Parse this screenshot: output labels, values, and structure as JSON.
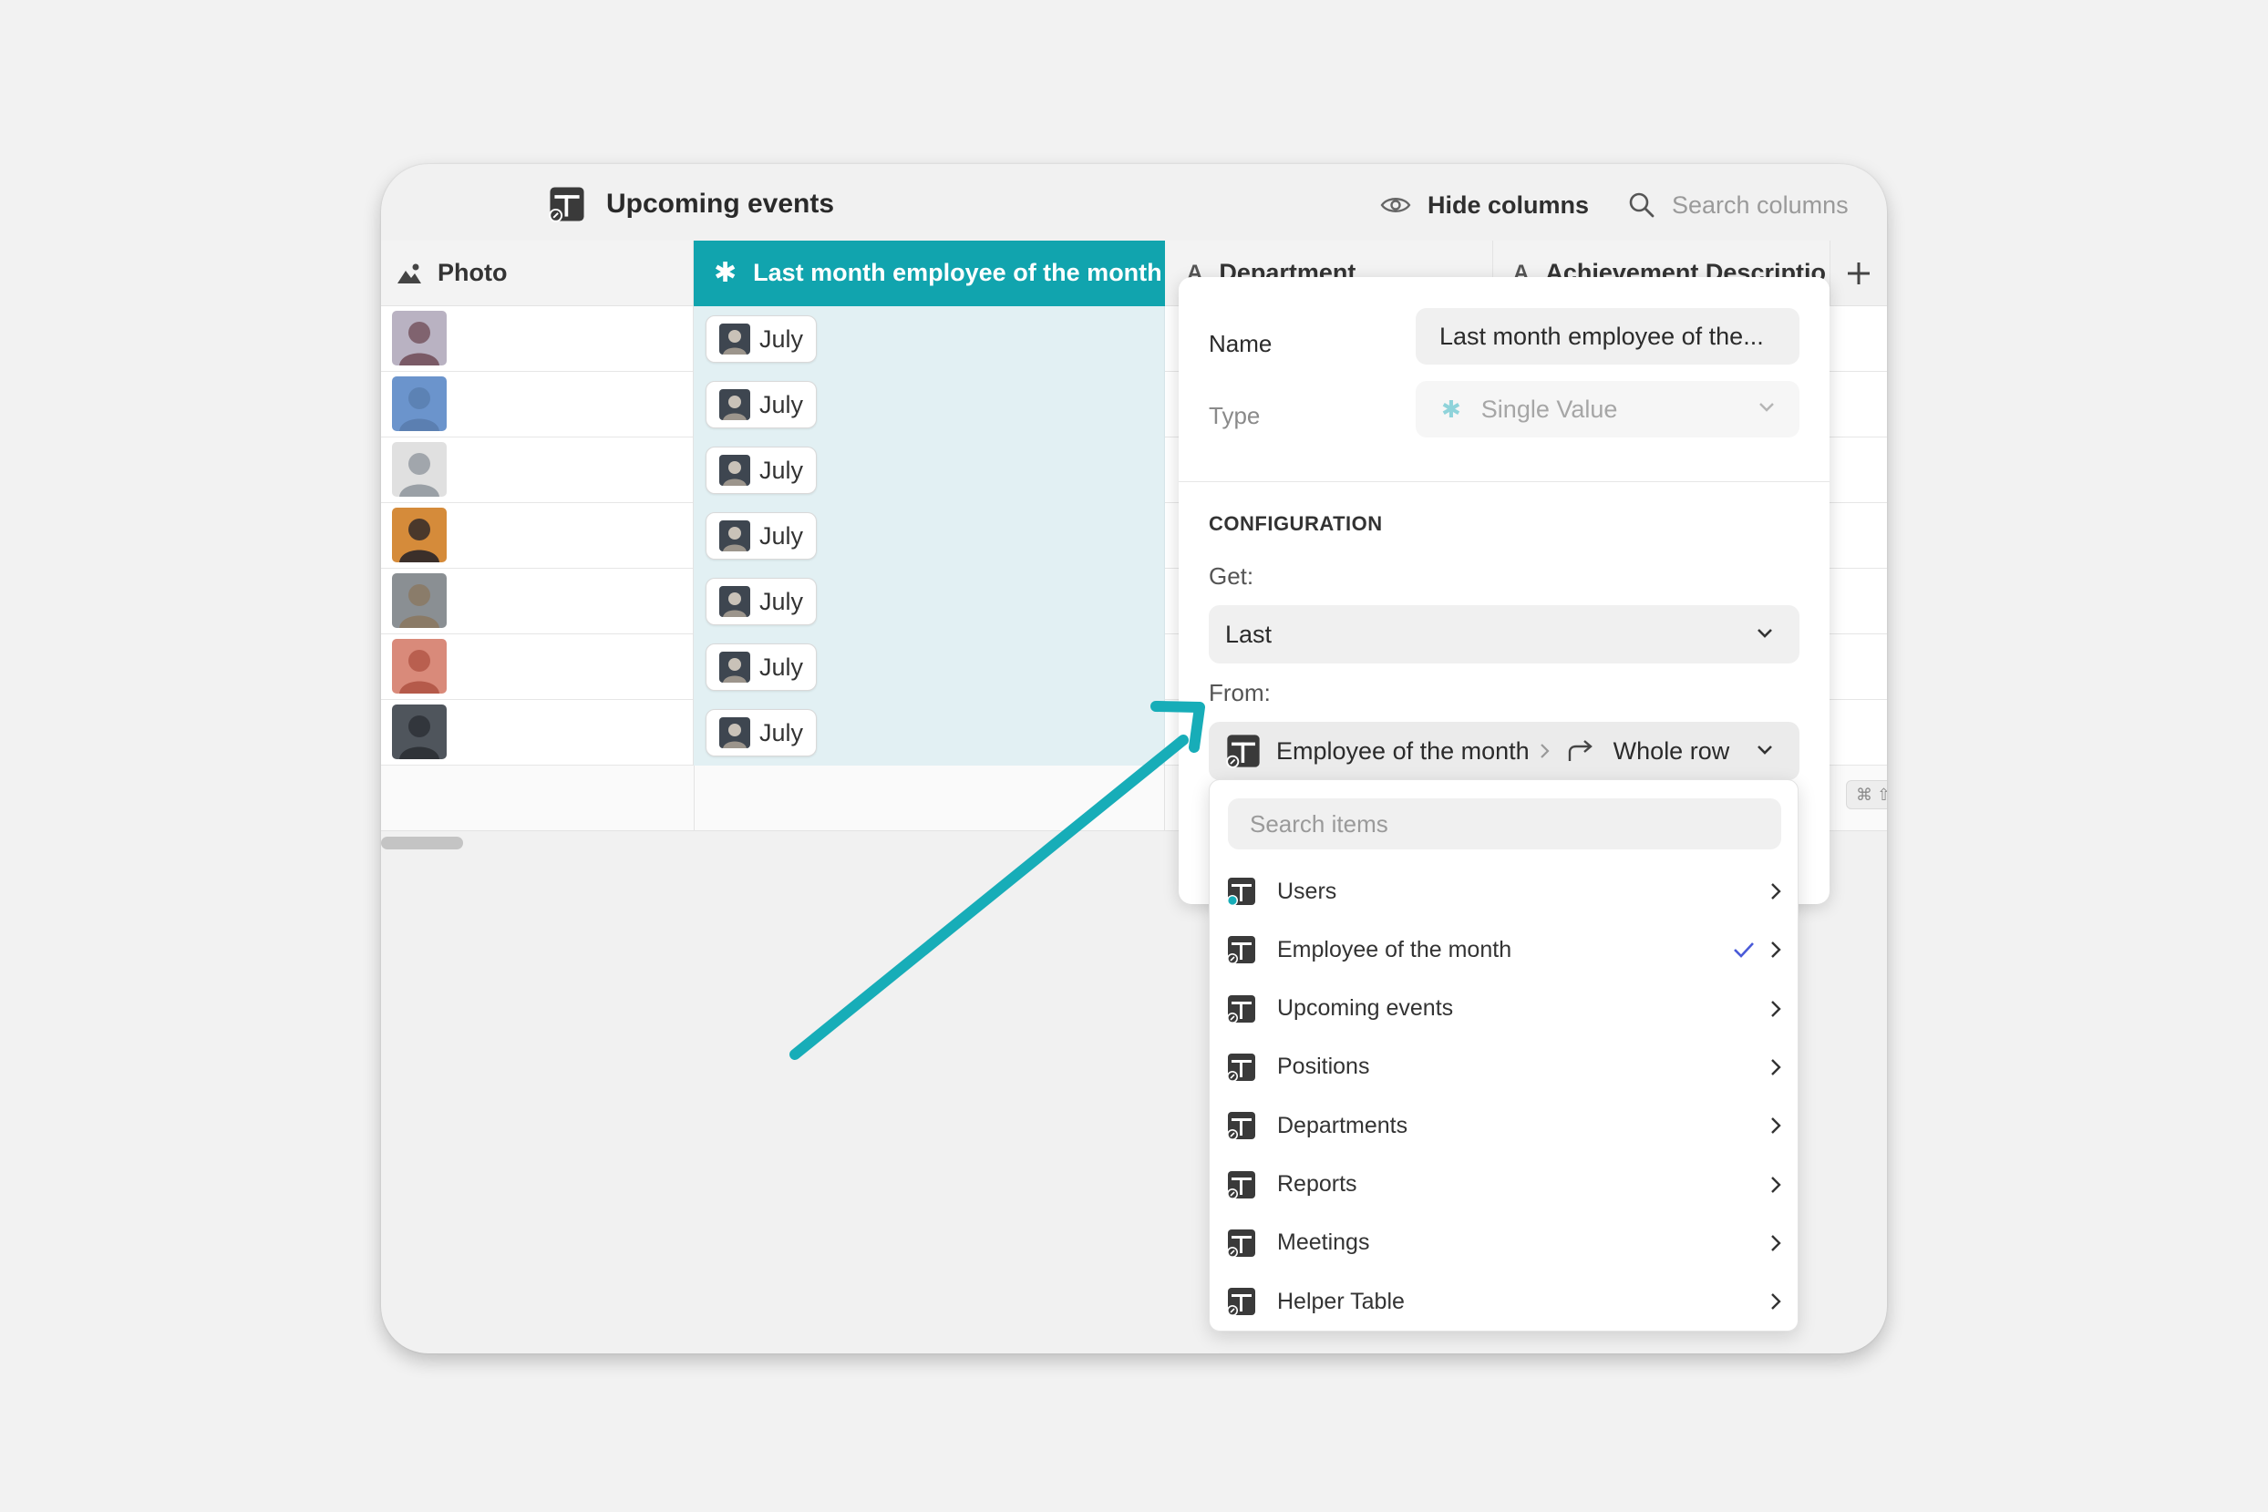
{
  "header": {
    "table_name": "Upcoming events",
    "hide_columns_label": "Hide columns",
    "search_placeholder": "Search columns"
  },
  "columns": [
    {
      "label": "Photo",
      "icon": "image-icon"
    },
    {
      "label": "Last month employee of the month",
      "icon": "asterisk-icon"
    },
    {
      "label": "Department",
      "icon": "text-icon"
    },
    {
      "label": "Achievement Descriptio",
      "icon": "text-icon"
    }
  ],
  "rows": [
    {
      "value": "July"
    },
    {
      "value": "July"
    },
    {
      "value": "July"
    },
    {
      "value": "July"
    },
    {
      "value": "July"
    },
    {
      "value": "July"
    },
    {
      "value": "July"
    }
  ],
  "panel": {
    "name_label": "Name",
    "name_value": "Last month employee of the...",
    "type_label": "Type",
    "type_value": "Single Value",
    "section_title": "CONFIGURATION",
    "get_label": "Get:",
    "get_value": "Last",
    "from_label": "From:",
    "from_table": "Employee of the month",
    "from_target": "Whole row",
    "shortcut_hint": "⌘ ⇧"
  },
  "dropdown": {
    "search_placeholder": "Search items",
    "items": [
      {
        "label": "Users",
        "selected": false
      },
      {
        "label": "Employee of the month",
        "selected": true
      },
      {
        "label": "Upcoming events",
        "selected": false
      },
      {
        "label": "Positions",
        "selected": false
      },
      {
        "label": "Departments",
        "selected": false
      },
      {
        "label": "Reports",
        "selected": false
      },
      {
        "label": "Meetings",
        "selected": false
      },
      {
        "label": "Helper Table",
        "selected": false
      }
    ]
  },
  "colors": {
    "accent": "#11a4ae",
    "accent_light": "#e2f0f3",
    "arrow": "#17adb8",
    "check": "#4a5bd8"
  }
}
